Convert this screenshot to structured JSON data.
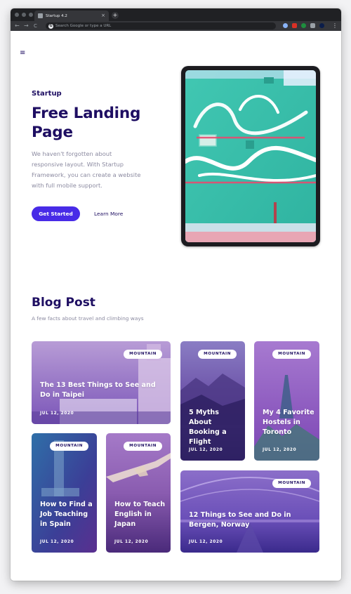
{
  "browser": {
    "tab_title": "Startup 4.2",
    "tab_close": "×",
    "new_tab": "+",
    "back": "←",
    "forward": "→",
    "reload": "C",
    "google_icon": "G",
    "address_placeholder": "Search Google or type a URL",
    "menu": "⋮"
  },
  "nav": {
    "menu_icon": "≡"
  },
  "hero": {
    "eyebrow": "Startup",
    "title": "Free Landing Page",
    "description": "We haven't forgotten about responsive layout. With Startup Framework, you can create a website with full mobile support.",
    "primary_button": "Get Started",
    "secondary_link": "Learn More"
  },
  "blog": {
    "title": "Blog Post",
    "subtitle": "A few facts about travel and climbing ways",
    "cards": [
      {
        "tag": "MOUNTAIN",
        "title": "The 13 Best Things to See and Do in Taipei",
        "date": "JUL 12, 2020"
      },
      {
        "tag": "MOUNTAIN",
        "title": "5 Myths About Booking a Flight",
        "date": "JUL 12, 2020"
      },
      {
        "tag": "MOUNTAIN",
        "title": "My 4 Favorite Hostels in Toronto",
        "date": "JUL 12, 2020"
      },
      {
        "tag": "MOUNTAIN",
        "title": "How to Find a Job Teaching in Spain",
        "date": "JUL 12, 2020"
      },
      {
        "tag": "MOUNTAIN",
        "title": "How to Teach English in Japan",
        "date": "JUL 12, 2020"
      },
      {
        "tag": "MOUNTAIN",
        "title": "12 Things to See and Do in Bergen, Norway",
        "date": "JUL 12, 2020"
      }
    ]
  },
  "colors": {
    "brand_dark": "#1e0e62",
    "accent": "#482be7",
    "muted_text": "#8b8aa0",
    "card_overlay": "#6a3fb5"
  },
  "icons": {
    "menu": "hamburger-menu-icon",
    "back": "arrow-left-icon",
    "forward": "arrow-right-icon",
    "reload": "reload-icon"
  }
}
